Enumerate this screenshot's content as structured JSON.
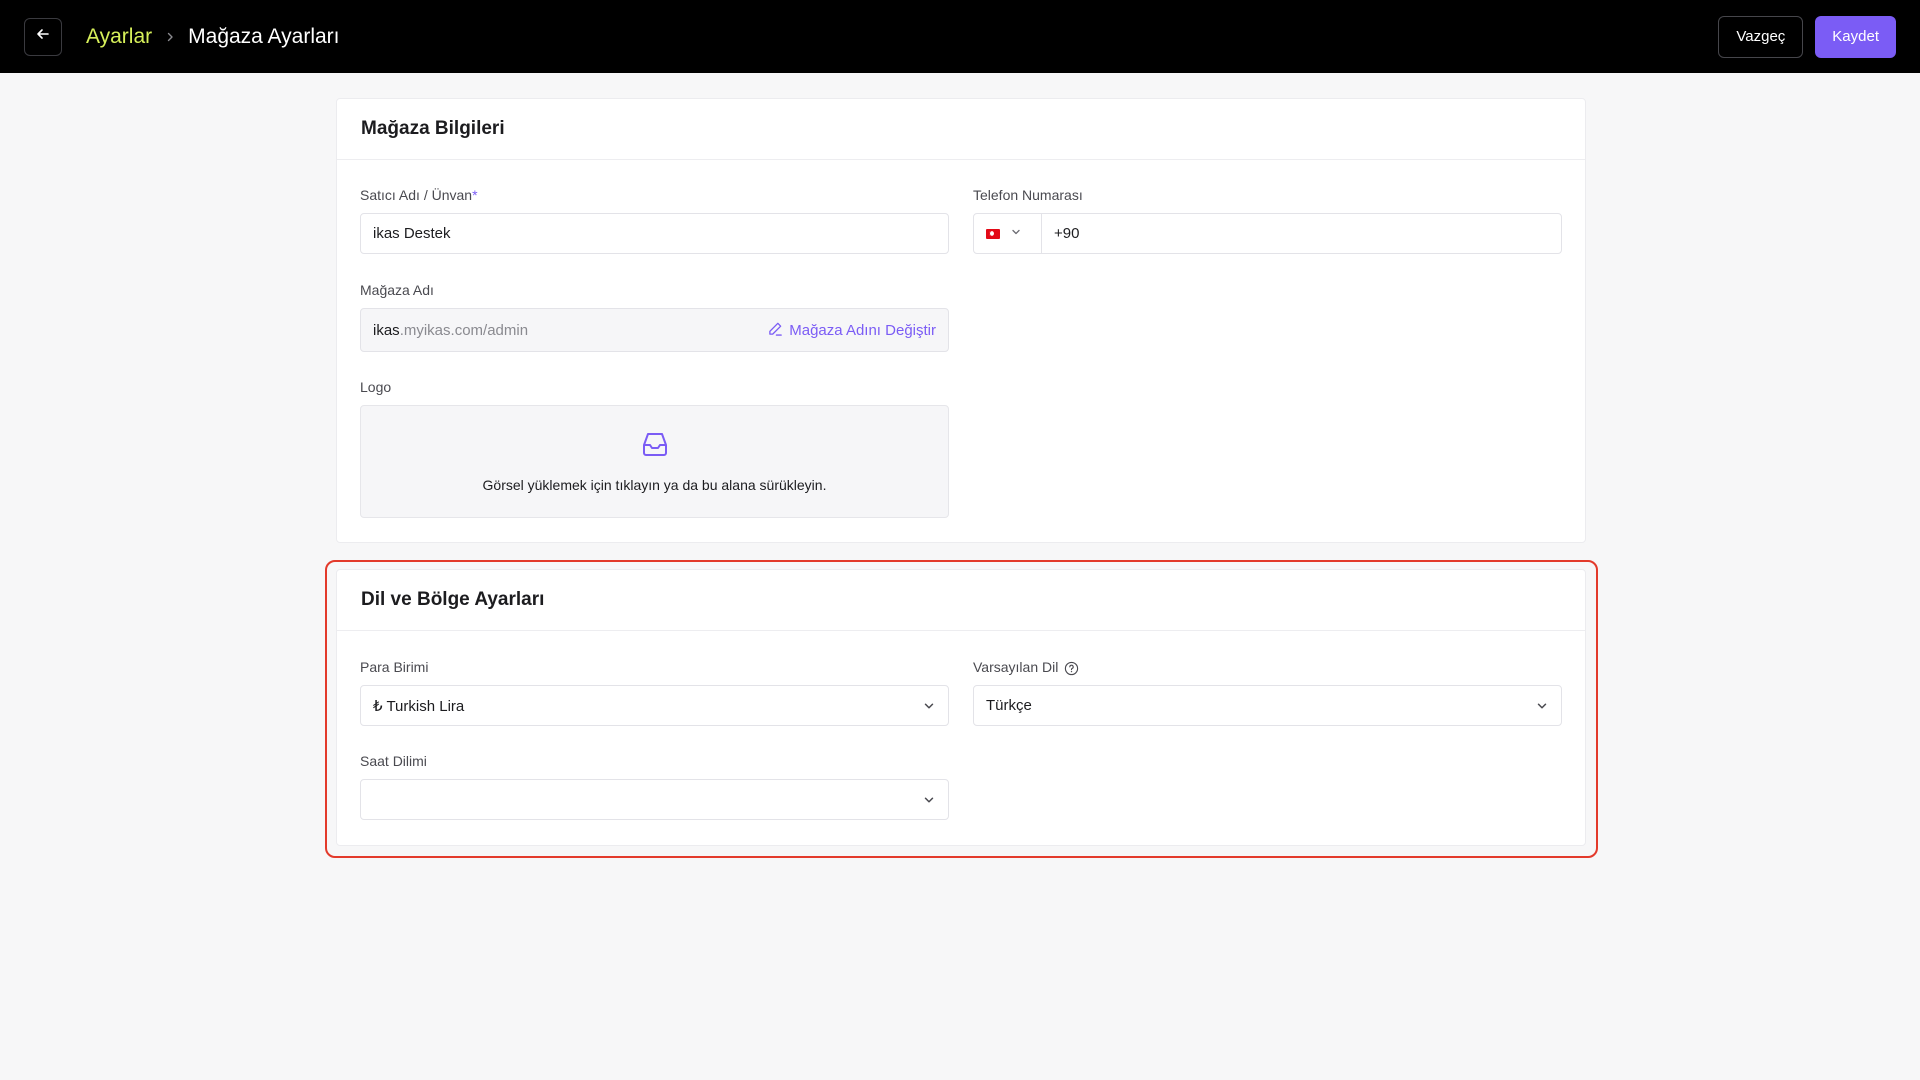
{
  "header": {
    "back_icon": "arrow-left-icon",
    "breadcrumb_root": "Ayarlar",
    "breadcrumb_current": "Mağaza Ayarları",
    "cancel_label": "Vazgeç",
    "save_label": "Kaydet",
    "accent_color": "#7b5cf5",
    "breadcrumb_root_color": "#d7f05a"
  },
  "store_info": {
    "title": "Mağaza Bilgileri",
    "seller_name_label": "Satıcı Adı / Ünvan",
    "seller_name_required": "*",
    "seller_name_value": "ikas Destek",
    "phone_label": "Telefon Numarası",
    "phone_country_flag": "turkey-flag-icon",
    "phone_value": "+90",
    "store_name_label": "Mağaza Adı",
    "store_name_prefix": "ikas",
    "store_name_suffix": ".myikas.com/admin",
    "change_store_name_label": "Mağaza Adını Değiştir",
    "logo_label": "Logo",
    "logo_upload_text": "Görsel yüklemek için tıklayın ya da bu alana sürükleyin.",
    "logo_upload_icon": "inbox-icon"
  },
  "region_settings": {
    "title": "Dil ve Bölge Ayarları",
    "currency_label": "Para Birimi",
    "currency_value": "₺ Turkish Lira",
    "default_language_label": "Varsayılan Dil",
    "default_language_value": "Türkçe",
    "timezone_label": "Saat Dilimi",
    "timezone_value": "",
    "highlight_color": "#e33a2b"
  }
}
